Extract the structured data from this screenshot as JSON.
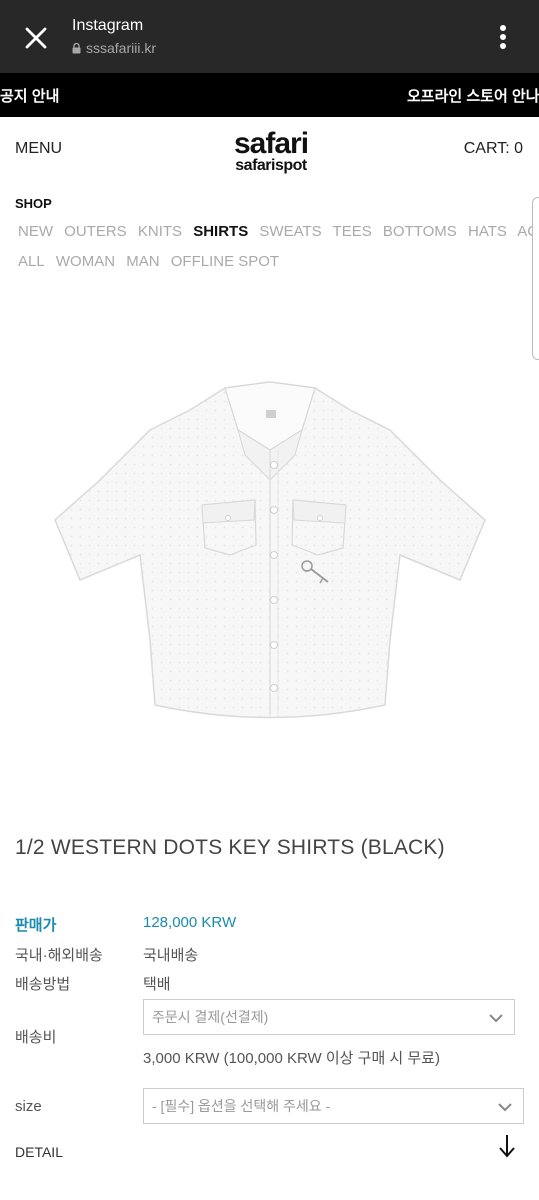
{
  "browser": {
    "title": "Instagram",
    "url": "sssafariii.kr"
  },
  "notice": {
    "left": "공지 안내",
    "right": "오프라인 스토어 안나"
  },
  "header": {
    "menu": "MENU",
    "logo_main": "safari",
    "logo_sub": "safarispot",
    "cart": "CART: 0"
  },
  "nav": {
    "shop_label": "SHOP",
    "row1": [
      "NEW",
      "OUTERS",
      "KNITS",
      "SHIRTS",
      "SWEATS",
      "TEES",
      "BOTTOMS",
      "HATS",
      "ACC"
    ],
    "row2": [
      "ALL",
      "WOMAN",
      "MAN",
      "OFFLINE SPOT"
    ],
    "active": "SHIRTS"
  },
  "product": {
    "name": "1/2 WESTERN DOTS KEY SHIRTS (BLACK)",
    "image_icon": "white-shirt-image"
  },
  "info": {
    "price_label": "판매가",
    "price_value": "128,000 KRW",
    "shipping_region_label": "국내·해외배송",
    "shipping_region_value": "국내배송",
    "shipping_method_label": "배송방법",
    "shipping_method_value": "택배",
    "shipping_fee_label": "배송비",
    "shipping_fee_select": "주문시 결제(선결제)",
    "shipping_fee_note": "3,000 KRW (100,000 KRW 이상 구매 시 무료)",
    "size_label": "size",
    "size_select": "- [필수] 옵션을 선택해 주세요 -",
    "detail_label": "DETAIL"
  },
  "colors": {
    "price_accent": "#1b8bad",
    "browser_bar": "#282828",
    "notice_bar": "#000000"
  }
}
